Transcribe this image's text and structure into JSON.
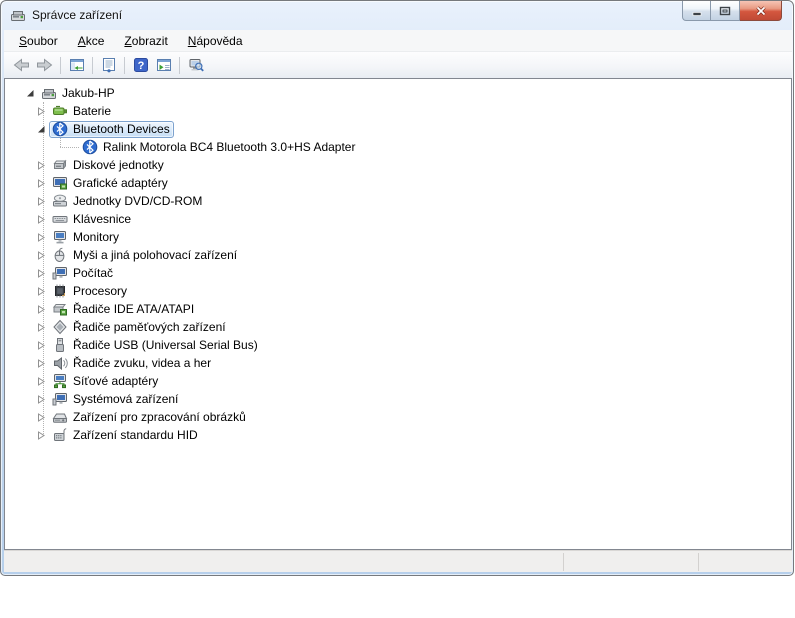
{
  "window": {
    "title": "Správce zařízení",
    "controls": {
      "minimize": "minimize",
      "restore": "restore",
      "close": "close"
    }
  },
  "menu": {
    "items": [
      {
        "accel": "S",
        "rest": "oubor"
      },
      {
        "accel": "A",
        "rest": "kce"
      },
      {
        "accel": "Z",
        "rest": "obrazit"
      },
      {
        "accel": "N",
        "rest": "ápověda"
      }
    ]
  },
  "toolbar": {
    "icons": [
      "back-icon",
      "forward-icon",
      "show-console-tree-icon",
      "properties-icon",
      "help-icon",
      "show-action-pane-icon",
      "scan-hardware-changes-icon"
    ]
  },
  "tree": {
    "items": [
      {
        "label": "Jakub-HP",
        "level": 0,
        "expander": "expanded",
        "icon": "computer",
        "selected": false
      },
      {
        "label": "Baterie",
        "level": 1,
        "expander": "collapsed",
        "icon": "battery",
        "selected": false
      },
      {
        "label": "Bluetooth Devices",
        "level": 1,
        "expander": "expanded",
        "icon": "bluetooth",
        "selected": true
      },
      {
        "label": "Ralink Motorola BC4 Bluetooth 3.0+HS Adapter",
        "level": 2,
        "expander": "none",
        "icon": "bluetooth",
        "selected": false
      },
      {
        "label": "Diskové jednotky",
        "level": 1,
        "expander": "collapsed",
        "icon": "disk-drive",
        "selected": false
      },
      {
        "label": "Grafické adaptéry",
        "level": 1,
        "expander": "collapsed",
        "icon": "display-adapter",
        "selected": false
      },
      {
        "label": "Jednotky DVD/CD-ROM",
        "level": 1,
        "expander": "collapsed",
        "icon": "dvd-drive",
        "selected": false
      },
      {
        "label": "Klávesnice",
        "level": 1,
        "expander": "collapsed",
        "icon": "keyboard",
        "selected": false
      },
      {
        "label": "Monitory",
        "level": 1,
        "expander": "collapsed",
        "icon": "monitor",
        "selected": false
      },
      {
        "label": "Myši a jiná polohovací zařízení",
        "level": 1,
        "expander": "collapsed",
        "icon": "mouse",
        "selected": false
      },
      {
        "label": "Počítač",
        "level": 1,
        "expander": "collapsed",
        "icon": "computer-device",
        "selected": false
      },
      {
        "label": "Procesory",
        "level": 1,
        "expander": "collapsed",
        "icon": "processor",
        "selected": false
      },
      {
        "label": "Řadiče IDE ATA/ATAPI",
        "level": 1,
        "expander": "collapsed",
        "icon": "ide-controller",
        "selected": false
      },
      {
        "label": "Řadiče paměťových zařízení",
        "level": 1,
        "expander": "collapsed",
        "icon": "storage-controller",
        "selected": false
      },
      {
        "label": "Řadiče USB (Universal Serial Bus)",
        "level": 1,
        "expander": "collapsed",
        "icon": "usb-controller",
        "selected": false
      },
      {
        "label": "Řadiče zvuku, videa a her",
        "level": 1,
        "expander": "collapsed",
        "icon": "sound-device",
        "selected": false
      },
      {
        "label": "Síťové adaptéry",
        "level": 1,
        "expander": "collapsed",
        "icon": "network-adapter",
        "selected": false
      },
      {
        "label": "Systémová zařízení",
        "level": 1,
        "expander": "collapsed",
        "icon": "system-device",
        "selected": false
      },
      {
        "label": "Zařízení pro zpracování obrázků",
        "level": 1,
        "expander": "collapsed",
        "icon": "imaging-device",
        "selected": false
      },
      {
        "label": "Zařízení standardu HID",
        "level": 1,
        "expander": "collapsed",
        "icon": "hid-device",
        "selected": false
      }
    ]
  },
  "status_bar": {
    "text": ""
  },
  "colors": {
    "frame": "#c4d8ee",
    "selection_fill": "#c6def5",
    "selection_border": "#7da2ce",
    "close_button": "#d4573f",
    "help_icon_blue": "#3e66c9"
  }
}
